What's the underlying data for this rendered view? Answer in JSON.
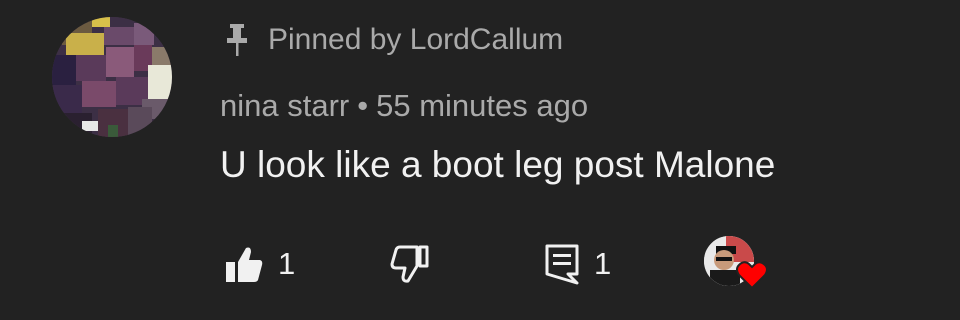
{
  "comment": {
    "pinned_label": "Pinned by LordCallum",
    "author": "nina starr",
    "separator": "•",
    "timestamp": "55 minutes ago",
    "text": "U look like a boot leg post Malone"
  },
  "actions": {
    "like_count": "1",
    "reply_count": "1"
  },
  "icons": {
    "pin": "pin-icon",
    "like": "thumbs-up-icon",
    "dislike": "thumbs-down-icon",
    "reply": "reply-icon",
    "creator_heart": "heart-icon"
  },
  "colors": {
    "background": "#222222",
    "secondary_text": "#aaaaaa",
    "primary_text": "#f1f1f1",
    "heart": "#ff0000"
  }
}
